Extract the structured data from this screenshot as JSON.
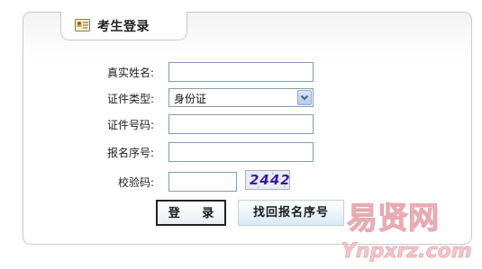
{
  "panel": {
    "title": "考生登录",
    "title_icon": "id-card-icon"
  },
  "form": {
    "real_name": {
      "label": "真实姓名:",
      "value": ""
    },
    "id_type": {
      "label": "证件类型:",
      "selected": "身份证"
    },
    "id_number": {
      "label": "证件号码:",
      "value": ""
    },
    "reg_number": {
      "label": "报名序号:",
      "value": ""
    },
    "captcha": {
      "label": "校验码:",
      "value": "",
      "image_text": "2442"
    }
  },
  "buttons": {
    "login": "登 录",
    "find": "找回报名序号"
  },
  "watermark": {
    "brand": "易贤网",
    "domain": "Ynpxrz.com"
  },
  "colors": {
    "field_border": "#7f9db9",
    "panel_border": "#c9c9c9",
    "watermark": "#e8b0b8",
    "captcha_text": "#3a1a9a"
  }
}
